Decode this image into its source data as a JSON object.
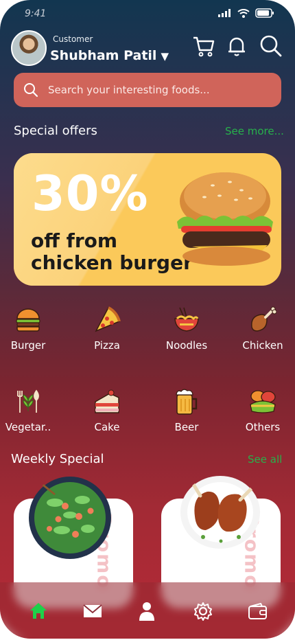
{
  "status": {
    "time": "9:41"
  },
  "header": {
    "role": "Customer",
    "user_name": "Shubham Patil"
  },
  "search": {
    "placeholder": "Search your interesting foods..."
  },
  "special_offers": {
    "title": "Special offers",
    "link": "See more...",
    "banner": {
      "percent": "30%",
      "line1": "off from",
      "line2": "chicken burger"
    }
  },
  "categories": [
    {
      "label": "Burger",
      "icon": "burger-icon"
    },
    {
      "label": "Pizza",
      "icon": "pizza-icon"
    },
    {
      "label": "Noodles",
      "icon": "noodles-icon"
    },
    {
      "label": "Chicken",
      "icon": "chicken-icon"
    },
    {
      "label": "Vegetar..",
      "icon": "vegetarian-icon"
    },
    {
      "label": "Cake",
      "icon": "cake-icon"
    },
    {
      "label": "Beer",
      "icon": "beer-icon"
    },
    {
      "label": "Others",
      "icon": "others-icon"
    }
  ],
  "weekly_special": {
    "title": "Weekly Special",
    "link": "See all",
    "promo_label": "Promo"
  },
  "nav": [
    "home-icon",
    "mail-icon",
    "profile-icon",
    "settings-icon",
    "wallet-icon"
  ],
  "colors": {
    "accent_green": "#27b14b",
    "search_bg": "#d0645a",
    "banner_bg": "#fbc95a"
  }
}
